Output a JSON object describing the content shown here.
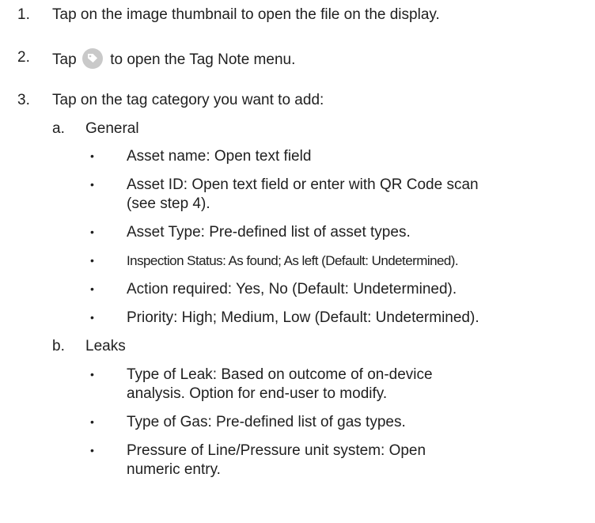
{
  "steps": [
    {
      "num": "1.",
      "text": "Tap on the image thumbnail to open the file on the display."
    },
    {
      "num": "2.",
      "text_before": "Tap",
      "icon": "tag-note-icon",
      "text_after": "to open the Tag Note menu."
    },
    {
      "num": "3.",
      "text": "Tap on the tag category you want to add:"
    }
  ],
  "categories": [
    {
      "letter": "a.",
      "label": "General",
      "items": [
        {
          "lines": [
            "Asset name: Open text field"
          ]
        },
        {
          "lines": [
            "Asset ID: Open text field or enter with QR Code scan",
            "(see step 4)."
          ]
        },
        {
          "lines": [
            "Asset Type: Pre-defined list of asset types."
          ]
        },
        {
          "lines": [
            "Inspection Status: As found; As left (Default: Undetermined)."
          ]
        },
        {
          "lines": [
            "Action required: Yes, No (Default: Undetermined)."
          ]
        },
        {
          "lines": [
            "Priority: High; Medium, Low (Default: Undetermined)."
          ]
        }
      ]
    },
    {
      "letter": "b.",
      "label": "Leaks",
      "items": [
        {
          "lines": [
            "Type of Leak: Based on outcome of on-device",
            "analysis. Option for end-user to modify."
          ]
        },
        {
          "lines": [
            "Type of Gas: Pre-defined list of gas types."
          ]
        },
        {
          "lines": [
            "Pressure of Line/Pressure unit system: Open",
            "numeric entry."
          ]
        }
      ]
    }
  ],
  "bullet_glyph": "•"
}
